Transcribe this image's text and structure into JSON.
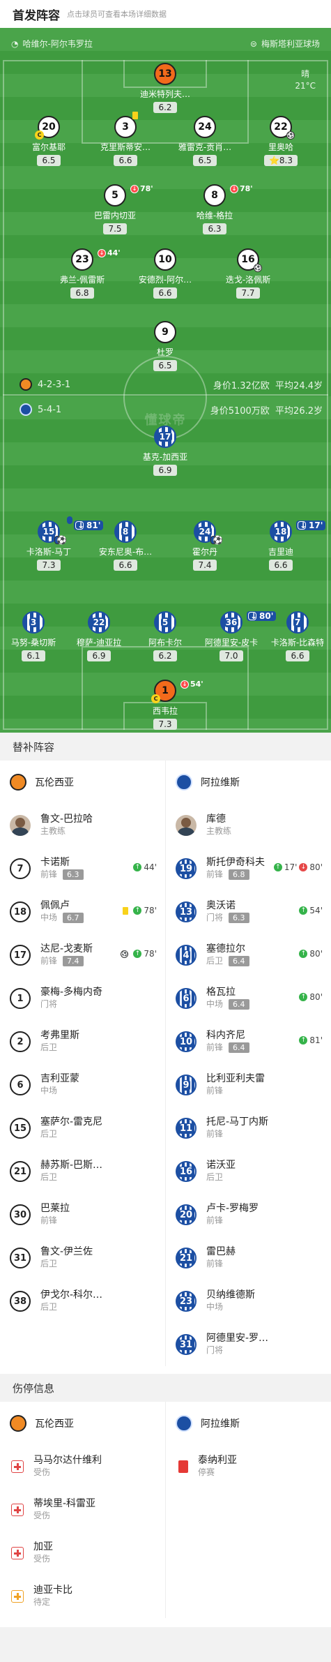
{
  "header": {
    "title": "首发阵容",
    "subtitle": "点击球员可查看本场详细数据"
  },
  "pitch": {
    "home_venue": "哈维尔-阿尔韦罗拉",
    "away_venue": "梅斯塔利亚球场",
    "weather": "晴",
    "temperature": "21°C",
    "watermark": "懂球帝",
    "home_formation": "4-2-3-1",
    "away_formation": "5-4-1",
    "home_value": "身价1.32亿欧",
    "home_age": "平均24.4岁",
    "away_value": "身价5100万欧",
    "away_age": "平均26.2岁"
  },
  "home_players": [
    {
      "num": "13",
      "name": "迪米特列夫…",
      "rating": "6.2"
    },
    {
      "num": "20",
      "name": "富尔基耶",
      "rating": "6.5"
    },
    {
      "num": "3",
      "name": "克里斯蒂安…",
      "rating": "6.6"
    },
    {
      "num": "24",
      "name": "雅雷克-贡肖…",
      "rating": "6.5"
    },
    {
      "num": "22",
      "name": "里奥哈",
      "rating": "8.3"
    },
    {
      "num": "5",
      "name": "巴雷内切亚",
      "rating": "7.5",
      "sub": "78'"
    },
    {
      "num": "8",
      "name": "哈维-格拉",
      "rating": "6.3",
      "sub": "78'"
    },
    {
      "num": "23",
      "name": "弗兰-佩雷斯",
      "rating": "6.8",
      "sub": "44'"
    },
    {
      "num": "10",
      "name": "安德烈-阿尔…",
      "rating": "6.6"
    },
    {
      "num": "16",
      "name": "迭戈-洛佩斯",
      "rating": "7.7"
    },
    {
      "num": "9",
      "name": "杜罗",
      "rating": "6.5"
    }
  ],
  "away_players": [
    {
      "num": "17",
      "name": "基克-加西亚",
      "rating": "6.9"
    },
    {
      "num": "15",
      "name": "卡洛斯-马丁",
      "rating": "7.3",
      "sub": "81'"
    },
    {
      "num": "8",
      "name": "安东尼奥-布…",
      "rating": "6.6"
    },
    {
      "num": "24",
      "name": "霍尔丹",
      "rating": "7.4"
    },
    {
      "num": "18",
      "name": "吉里迪",
      "rating": "6.6",
      "sub": "17'"
    },
    {
      "num": "3",
      "name": "马努-桑切斯",
      "rating": "6.1"
    },
    {
      "num": "22",
      "name": "穆萨-迪亚拉",
      "rating": "6.9"
    },
    {
      "num": "5",
      "name": "阿布卡尔",
      "rating": "6.2"
    },
    {
      "num": "36",
      "name": "阿德里安-皮卡",
      "rating": "7.0",
      "sub": "80'"
    },
    {
      "num": "7",
      "name": "卡洛斯-比森特",
      "rating": "6.6"
    },
    {
      "num": "1",
      "name": "西韦拉",
      "rating": "7.3",
      "sub": "54'"
    }
  ],
  "subs": {
    "title": "替补阵容",
    "home_team": "瓦伦西亚",
    "away_team": "阿拉维斯",
    "home_coach": {
      "name": "鲁文-巴拉哈",
      "role": "主教练"
    },
    "away_coach": {
      "name": "库德",
      "role": "主教练"
    },
    "home": [
      {
        "num": "7",
        "name": "卡诺斯",
        "pos": "前锋",
        "rating": "6.3",
        "evt": "44'"
      },
      {
        "num": "18",
        "name": "佩佩卢",
        "pos": "中场",
        "rating": "6.7",
        "evt": "78'"
      },
      {
        "num": "17",
        "name": "达尼-戈麦斯",
        "pos": "前锋",
        "rating": "7.4",
        "evt": "78'"
      },
      {
        "num": "1",
        "name": "豪梅-多梅内奇",
        "pos": "门将"
      },
      {
        "num": "2",
        "name": "考弗里斯",
        "pos": "后卫"
      },
      {
        "num": "6",
        "name": "吉利亚蒙",
        "pos": "中场"
      },
      {
        "num": "15",
        "name": "塞萨尔-雷克尼",
        "pos": "后卫"
      },
      {
        "num": "21",
        "name": "赫苏斯-巴斯…",
        "pos": "后卫"
      },
      {
        "num": "30",
        "name": "巴莱拉",
        "pos": "前锋"
      },
      {
        "num": "31",
        "name": "鲁文-伊兰佐",
        "pos": "后卫"
      },
      {
        "num": "38",
        "name": "伊戈尔-科尔…",
        "pos": "后卫"
      }
    ],
    "away": [
      {
        "num": "19",
        "name": "斯托伊奇科夫",
        "pos": "前锋",
        "rating": "6.8",
        "evt1": "17'",
        "evt2": "80'"
      },
      {
        "num": "13",
        "name": "奥沃诺",
        "pos": "门将",
        "rating": "6.3",
        "evt": "54'"
      },
      {
        "num": "4",
        "name": "塞德拉尔",
        "pos": "后卫",
        "rating": "6.4",
        "evt": "80'"
      },
      {
        "num": "6",
        "name": "格瓦拉",
        "pos": "中场",
        "rating": "6.4",
        "evt": "80'"
      },
      {
        "num": "10",
        "name": "科内齐尼",
        "pos": "前锋",
        "rating": "6.4",
        "evt": "81'"
      },
      {
        "num": "9",
        "name": "比利亚利夫雷",
        "pos": "前锋"
      },
      {
        "num": "11",
        "name": "托尼-马丁内斯",
        "pos": "前锋"
      },
      {
        "num": "16",
        "name": "诺沃亚",
        "pos": "后卫"
      },
      {
        "num": "20",
        "name": "卢卡-罗梅罗",
        "pos": "前锋"
      },
      {
        "num": "21",
        "name": "雷巴赫",
        "pos": "前锋"
      },
      {
        "num": "23",
        "name": "贝纳维德斯",
        "pos": "中场"
      },
      {
        "num": "31",
        "name": "阿德里安-罗…",
        "pos": "门将"
      }
    ]
  },
  "injuries": {
    "title": "伤停信息",
    "home_team": "瓦伦西亚",
    "away_team": "阿拉维斯",
    "home": [
      {
        "name": "马马尔达什维利",
        "status": "受伤"
      },
      {
        "name": "蒂埃里-科雷亚",
        "status": "受伤"
      },
      {
        "name": "加亚",
        "status": "受伤"
      },
      {
        "name": "迪亚卡比",
        "status": "待定"
      }
    ],
    "away": [
      {
        "name": "泰纳利亚",
        "status": "停赛"
      }
    ]
  }
}
